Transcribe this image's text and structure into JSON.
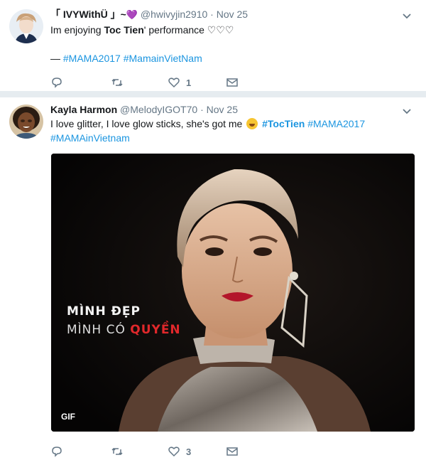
{
  "tweets": [
    {
      "display_name": "「 IVYWithÜ 」~",
      "name_emoji": "💜",
      "handle": "@hwivyjin2910",
      "separator": "·",
      "time": "Nov 25",
      "text_prefix": "Im enjoying ",
      "text_bold": "Toc Tien",
      "text_suffix": "' performance ♡♡♡",
      "dash": "— ",
      "hashtags": [
        "#MAMA2017",
        "#MamainVietNam"
      ],
      "like_count": "1",
      "avatar_icon": "profile-avatar"
    },
    {
      "display_name": "Kayla Harmon",
      "handle": "@MelodyIGOT70",
      "separator": "·",
      "time": "Nov 25",
      "text_prefix": "I love glitter, I love glow sticks, she's got me ",
      "hashtag_bold": "#TocTien",
      "hashtags": [
        "#MAMA2017",
        "#MAMAinVietnam"
      ],
      "like_count": "3",
      "avatar_icon": "profile-avatar",
      "media": {
        "caption_line1": "MÌNH ĐẸP",
        "caption_line2_prefix": "MÌNH CÓ ",
        "caption_line2_red": "QUYỀN",
        "badge": "GIF"
      }
    }
  ],
  "icons": {
    "reply": "reply-icon",
    "retweet": "retweet-icon",
    "like": "heart-icon",
    "dm": "envelope-icon",
    "caret": "chevron-down-icon",
    "emoji": "laughing-emoji-icon"
  },
  "colors": {
    "link": "#1b95e0",
    "meta": "#657786",
    "divider": "#e6ecf0",
    "caption_red": "#e0282b"
  }
}
